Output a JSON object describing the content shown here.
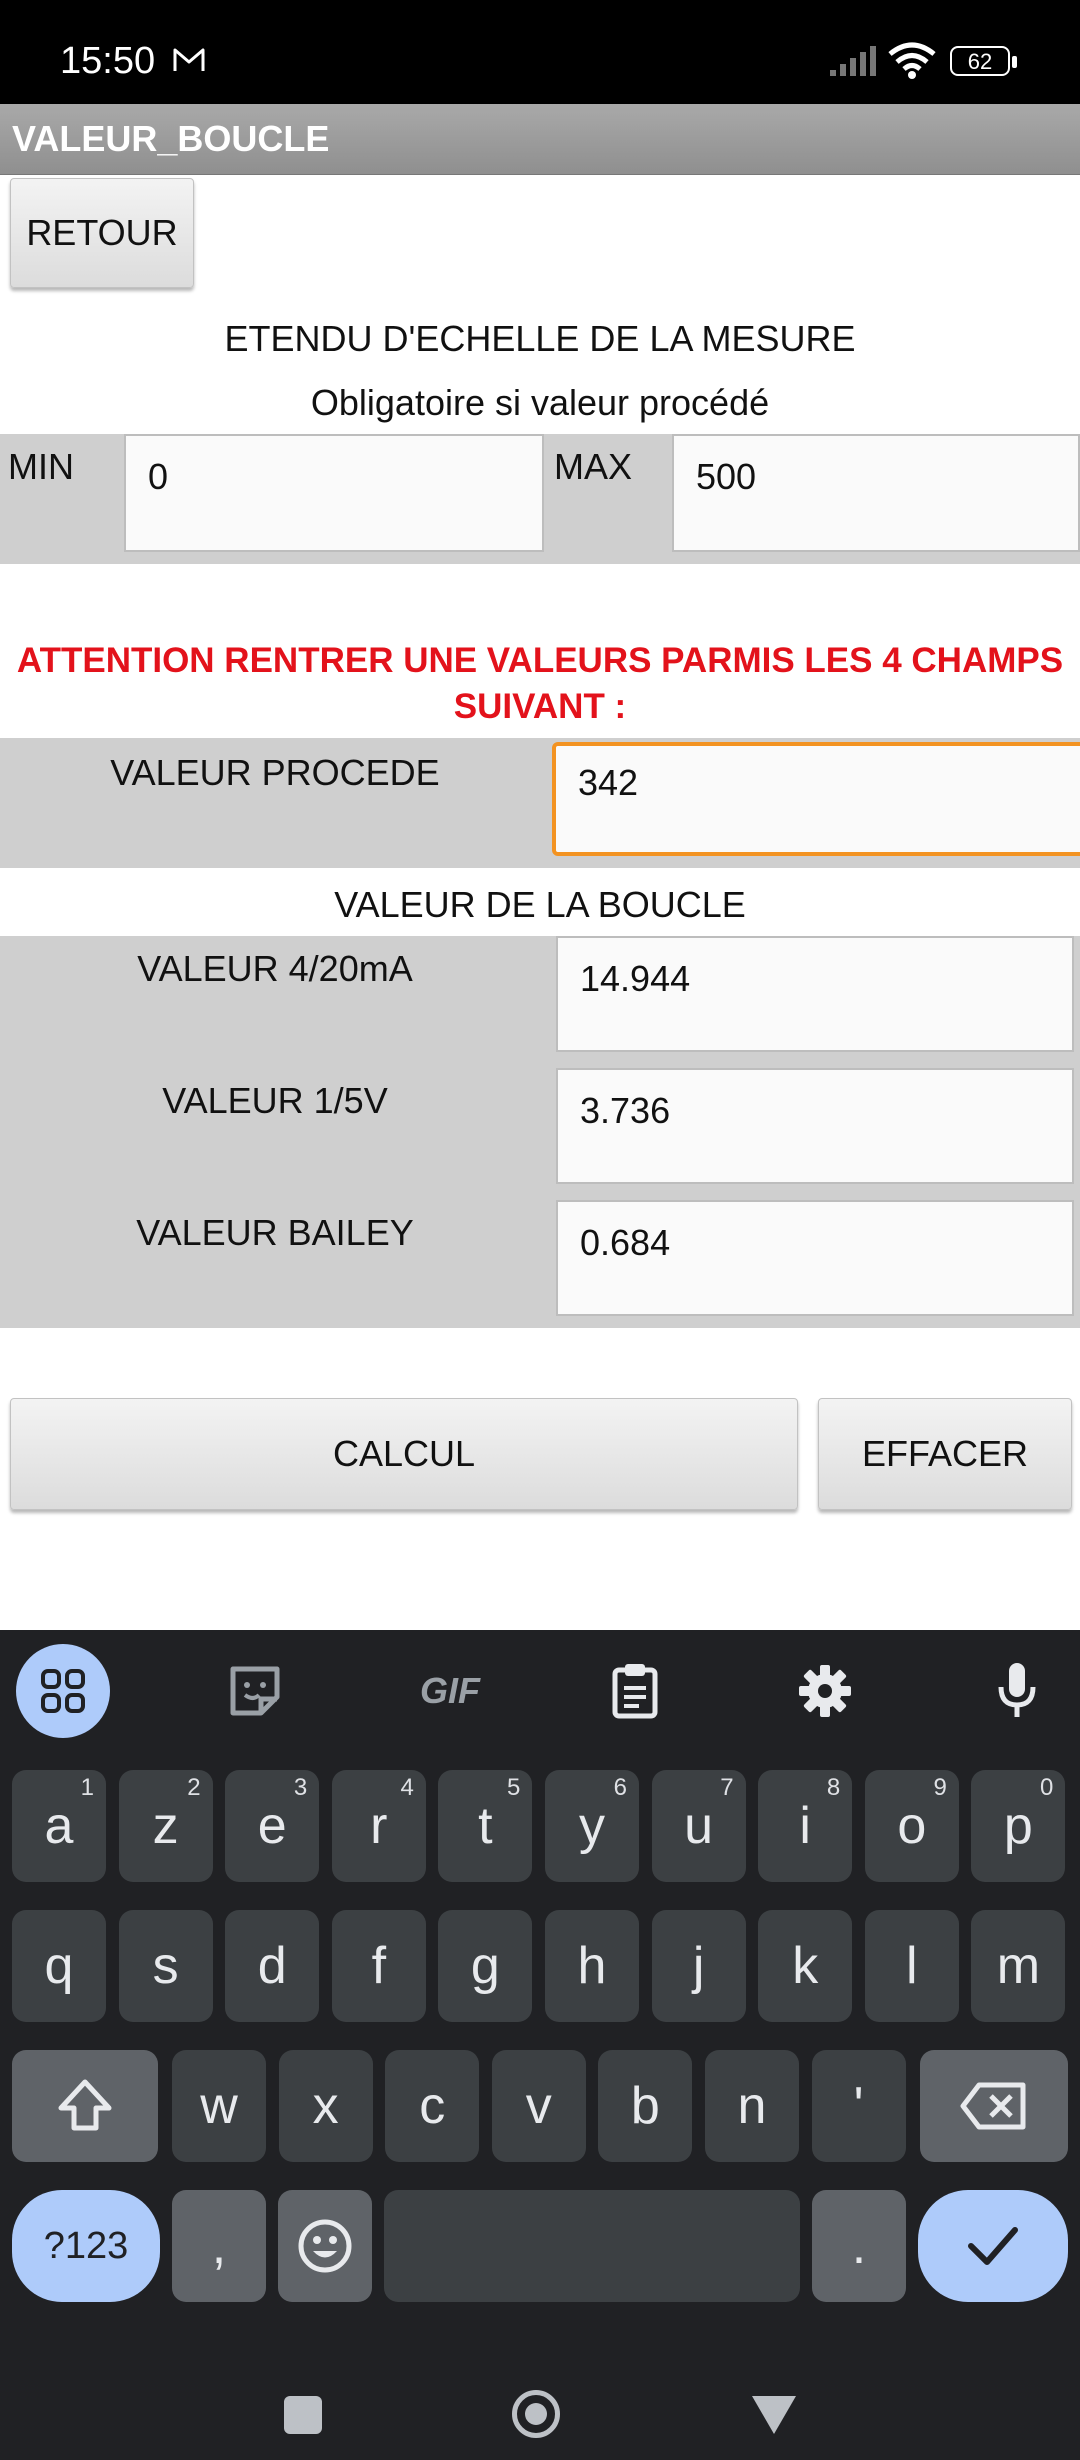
{
  "status": {
    "time": "15:50",
    "battery": "62"
  },
  "app": {
    "title": "VALEUR_BOUCLE",
    "back_label": "RETOUR",
    "section_title": "ETENDU D'ECHELLE DE LA MESURE",
    "section_subtitle": "Obligatoire si valeur procédé",
    "min_label": "MIN",
    "min_value": "0",
    "max_label": "MAX",
    "max_value": "500",
    "warning": "ATTENTION RENTRER UNE VALEURS PARMIS LES 4 CHAMPS SUIVANT :",
    "process_label": "VALEUR PROCEDE",
    "process_value": "342",
    "loop_title": "VALEUR DE LA BOUCLE",
    "ma_label": "VALEUR 4/20mA",
    "ma_value": "14.944",
    "v_label": "VALEUR 1/5V",
    "v_value": "3.736",
    "bailey_label": "VALEUR BAILEY",
    "bailey_value": "0.684",
    "calc_label": "CALCUL",
    "clear_label": "EFFACER",
    "accent_color": "#f39321",
    "warning_color": "#e3121b"
  },
  "keyboard": {
    "toolbar_gif": "GIF",
    "row1": [
      {
        "k": "a",
        "h": "1"
      },
      {
        "k": "z",
        "h": "2"
      },
      {
        "k": "e",
        "h": "3"
      },
      {
        "k": "r",
        "h": "4"
      },
      {
        "k": "t",
        "h": "5"
      },
      {
        "k": "y",
        "h": "6"
      },
      {
        "k": "u",
        "h": "7"
      },
      {
        "k": "i",
        "h": "8"
      },
      {
        "k": "o",
        "h": "9"
      },
      {
        "k": "p",
        "h": "0"
      }
    ],
    "row2": [
      "q",
      "s",
      "d",
      "f",
      "g",
      "h",
      "j",
      "k",
      "l",
      "m"
    ],
    "row3": [
      "w",
      "x",
      "c",
      "v",
      "b",
      "n",
      "'"
    ],
    "symbols_label": "?123",
    "comma": ",",
    "period": "."
  }
}
